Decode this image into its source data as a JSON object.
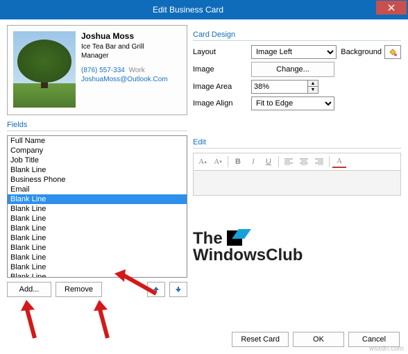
{
  "window": {
    "title": "Edit Business Card",
    "close": "×"
  },
  "card": {
    "name": "Joshua Moss",
    "company": "Ice Tea Bar and Grill",
    "title": "Manager",
    "phone": "(876) 557-334",
    "phone_kind": "Work",
    "email": "JoshuaMoss@Outlook.Com"
  },
  "design": {
    "group": "Card Design",
    "layout_lbl": "Layout",
    "layout_val": "Image Left",
    "bg_lbl": "Background",
    "image_lbl": "Image",
    "change_btn": "Change...",
    "area_lbl": "Image Area",
    "area_val": "38%",
    "align_lbl": "Image Align",
    "align_val": "Fit to Edge"
  },
  "fields": {
    "group": "Fields",
    "add_btn": "Add...",
    "remove_btn": "Remove",
    "list": [
      {
        "label": "Full Name",
        "sel": false
      },
      {
        "label": "Company",
        "sel": false
      },
      {
        "label": "Job Title",
        "sel": false
      },
      {
        "label": "Blank Line",
        "sel": false
      },
      {
        "label": "Business Phone",
        "sel": false
      },
      {
        "label": "Email",
        "sel": false
      },
      {
        "label": "Blank Line",
        "sel": true
      },
      {
        "label": "Blank Line",
        "sel": false
      },
      {
        "label": "Blank Line",
        "sel": false
      },
      {
        "label": "Blank Line",
        "sel": false
      },
      {
        "label": "Blank Line",
        "sel": false
      },
      {
        "label": "Blank Line",
        "sel": false
      },
      {
        "label": "Blank Line",
        "sel": false
      },
      {
        "label": "Blank Line",
        "sel": false
      },
      {
        "label": "Blank Line",
        "sel": false
      }
    ]
  },
  "edit": {
    "group": "Edit"
  },
  "buttons": {
    "reset": "Reset Card",
    "ok": "OK",
    "cancel": "Cancel"
  },
  "logo": {
    "line1": "The",
    "line2": "WindowsClub"
  },
  "watermark": "wsxdn.com"
}
